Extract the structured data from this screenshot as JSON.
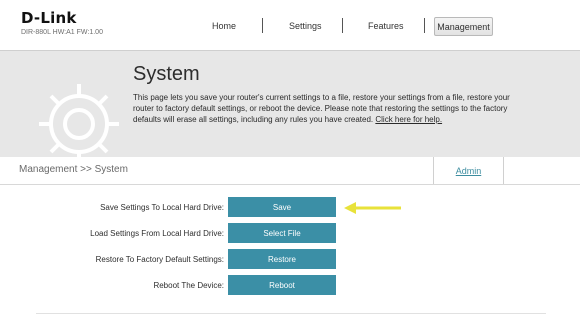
{
  "header": {
    "logo": "D-Link",
    "model": "DIR-880L   HW:A1   FW:1.00",
    "nav": {
      "home": "Home",
      "settings": "Settings",
      "features": "Features",
      "management": "Management"
    }
  },
  "hero": {
    "title": "System",
    "description": "This page lets you save your router's current settings to a file, restore your settings from a file, restore your router to factory default settings, or reboot the device. Please note that restoring the settings to the factory defaults will erase all settings, including any rules you have created.",
    "help_link": "Click here for help."
  },
  "breadcrumb": {
    "path": "Management >> System",
    "admin_tab": "Admin"
  },
  "rows": [
    {
      "label": "Save Settings To Local Hard Drive:",
      "button": "Save"
    },
    {
      "label": "Load Settings From Local Hard Drive:",
      "button": "Select File"
    },
    {
      "label": "Restore To Factory Default Settings:",
      "button": "Restore"
    },
    {
      "label": "Reboot The Device:",
      "button": "Reboot"
    }
  ],
  "colors": {
    "accent": "#3b8fa6",
    "arrow": "#e8e23a"
  }
}
